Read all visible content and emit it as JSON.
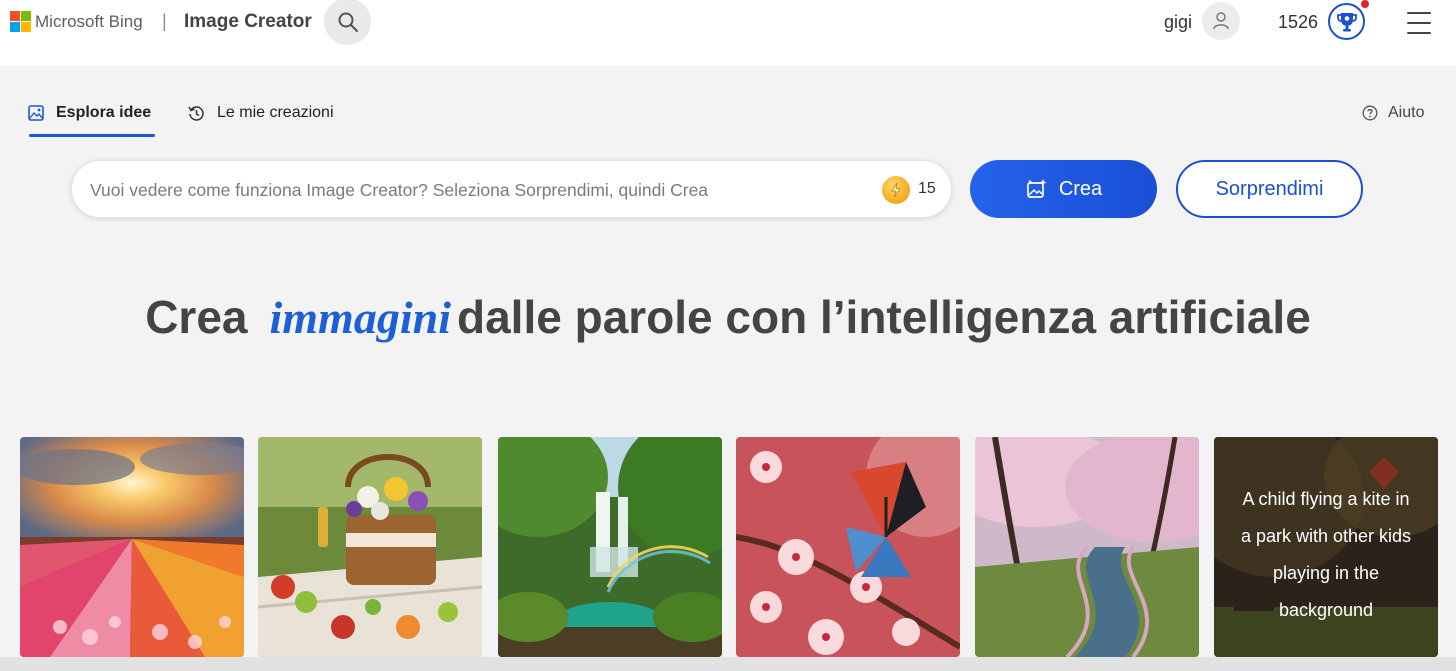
{
  "header": {
    "brand": "Microsoft Bing",
    "separator": "|",
    "product": "Image Creator",
    "user_name": "gigi",
    "points": "1526",
    "icons": {
      "logo": "microsoft-logo",
      "search": "search-icon",
      "avatar": "user-icon",
      "rewards": "rewards-trophy-icon",
      "menu": "hamburger-menu-icon"
    }
  },
  "tabs": [
    {
      "label": "Esplora idee",
      "icon": "image-icon",
      "selected": true
    },
    {
      "label": "Le mie creazioni",
      "icon": "history-icon",
      "selected": false
    }
  ],
  "help": {
    "label": "Aiuto",
    "icon": "help-circle-icon"
  },
  "prompt": {
    "placeholder": "Vuoi vedere come funziona Image Creator? Seleziona Sorprendimi, quindi Crea",
    "value": "",
    "boosts": "15",
    "boost_icon": "lightning-coin-icon"
  },
  "buttons": {
    "create": "Crea",
    "create_icon": "image-sparkle-icon",
    "surprise": "Sorprendimi"
  },
  "headline": {
    "before": "Crea",
    "accent": "immagini",
    "after": "dalle parole con l’intelligenza artificiale"
  },
  "gallery": [
    {
      "type": "image",
      "subject": "tulip-field-sunset"
    },
    {
      "type": "image",
      "subject": "picnic-basket-flowers"
    },
    {
      "type": "image",
      "subject": "waterfall-rainbow-jungle"
    },
    {
      "type": "image",
      "subject": "butterfly-cherry-blossom"
    },
    {
      "type": "image",
      "subject": "cherry-blossom-stream"
    },
    {
      "type": "prompt",
      "text_lines": [
        "A child flying a kite in",
        "a park with other kids",
        "playing in the",
        "background"
      ]
    }
  ],
  "colors": {
    "accent": "#1a4fd6",
    "page_background": "#f3f3f3",
    "header_background": "#ffffff"
  }
}
